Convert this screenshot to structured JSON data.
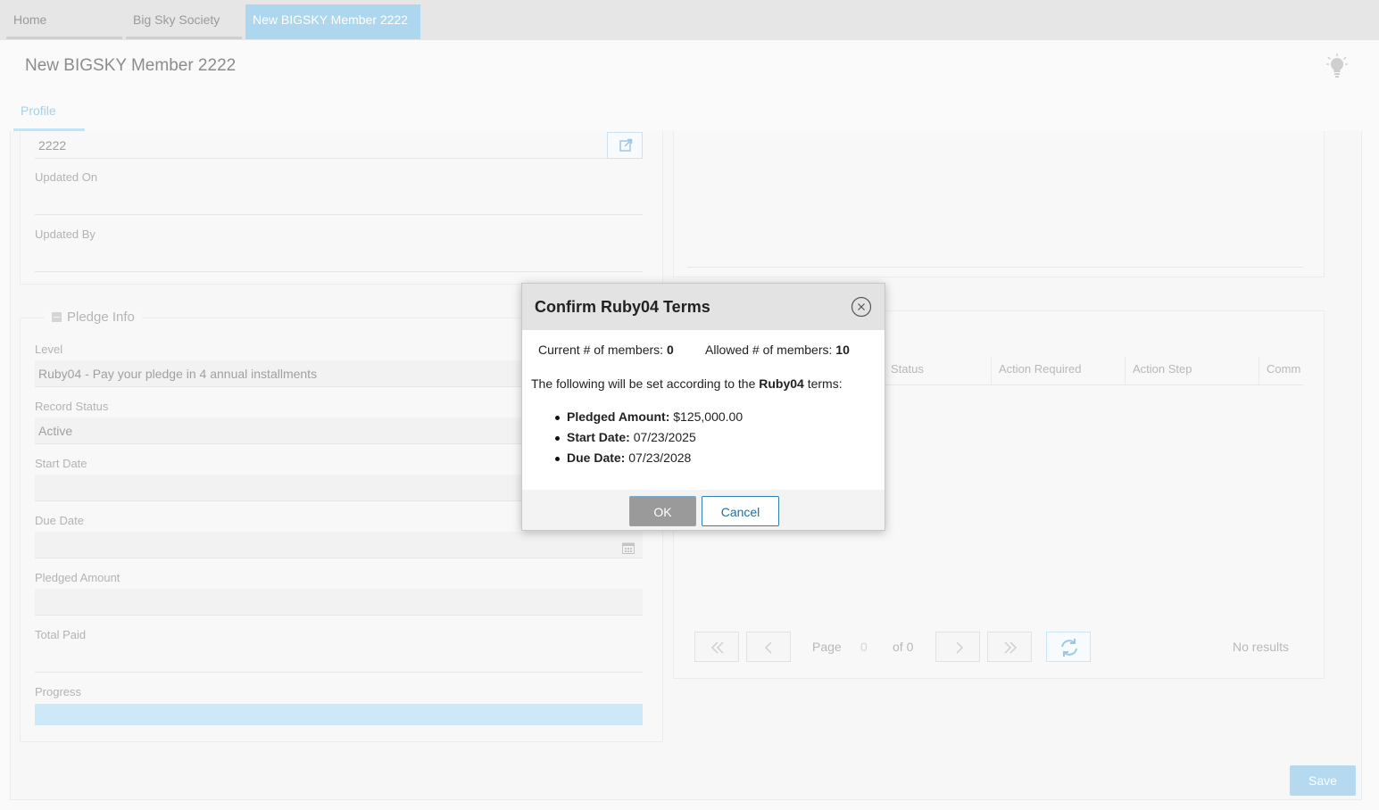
{
  "tabs": [
    {
      "label": "Home"
    },
    {
      "label": "Big Sky Society"
    },
    {
      "label": "New BIGSKY Member 2222"
    }
  ],
  "page": {
    "title": "New BIGSKY Member 2222",
    "subtab": "Profile"
  },
  "record": {
    "id_value": "2222",
    "updated_on_label": "Updated On",
    "updated_on_value": "",
    "updated_by_label": "Updated By",
    "updated_by_value": ""
  },
  "pledge": {
    "section_title": "Pledge Info",
    "level_label": "Level",
    "level_value": "Ruby04 - Pay your pledge in 4 annual installments",
    "status_label": "Record Status",
    "status_value": "Active",
    "start_label": "Start Date",
    "start_value": "",
    "due_label": "Due Date",
    "due_value": "",
    "amount_label": "Pledged Amount",
    "amount_value": "",
    "paid_label": "Total Paid",
    "paid_value": "",
    "progress_label": "Progress",
    "progress_value": 0
  },
  "grid": {
    "columns": [
      "Status",
      "Action Required",
      "Action Step",
      "Comm"
    ],
    "pager_page_label": "Page",
    "pager_page_value": "0",
    "pager_of": "of 0",
    "no_results": "No results"
  },
  "footer": {
    "save_label": "Save"
  },
  "dialog": {
    "title": "Confirm Ruby04 Terms",
    "current_label": "Current # of members:",
    "current_value": "0",
    "allowed_label": "Allowed # of members:",
    "allowed_value": "10",
    "terms_prefix": "The following will be set according to the",
    "terms_level": "Ruby04",
    "terms_suffix": "terms:",
    "items": [
      {
        "label": "Pledged Amount:",
        "value": "$125,000.00"
      },
      {
        "label": "Start Date:",
        "value": "07/23/2025"
      },
      {
        "label": "Due Date:",
        "value": "07/23/2028"
      }
    ],
    "ok_label": "OK",
    "cancel_label": "Cancel"
  },
  "colors": {
    "accent": "#add6ef",
    "cancel_border": "#2f7fb5"
  }
}
